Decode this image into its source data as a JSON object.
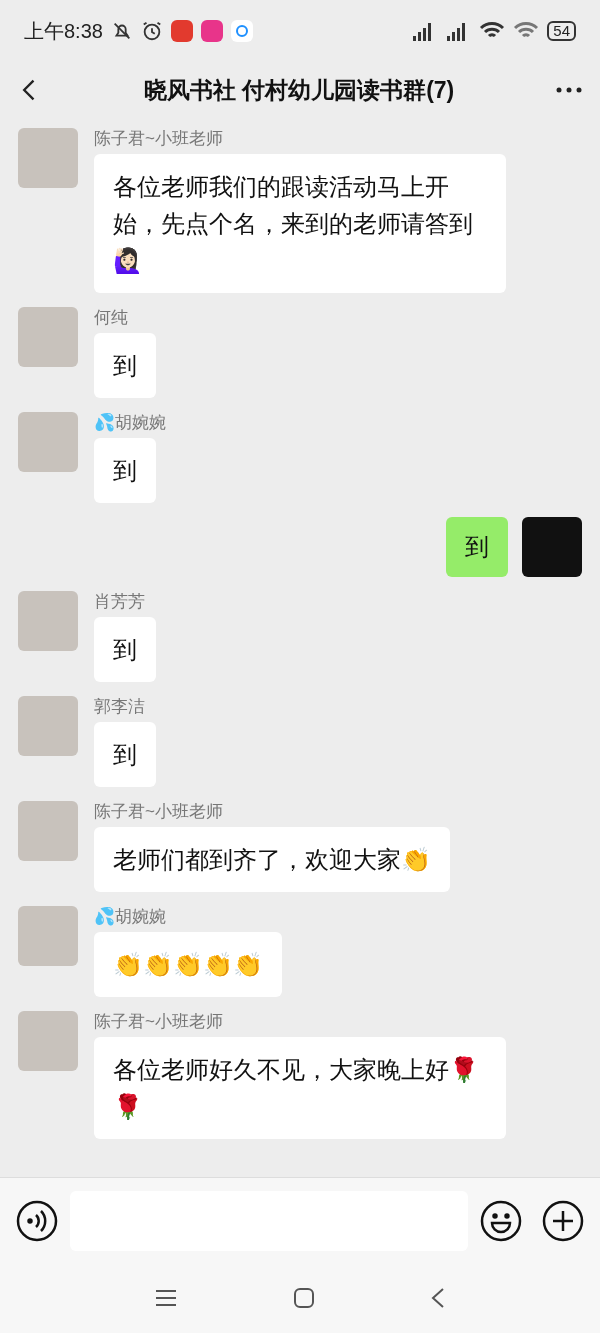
{
  "status_bar": {
    "time": "上午8:38",
    "battery": "54"
  },
  "header": {
    "title": "晓风书社 付村幼儿园读书群(7)"
  },
  "messages": [
    {
      "kind": "in",
      "sender": "陈子君~小班老师",
      "text": "各位老师我们的跟读活动马上开始，先点个名，来到的老师请答到🙋🏻‍♀️"
    },
    {
      "kind": "in",
      "sender": "何纯",
      "text": "到"
    },
    {
      "kind": "in",
      "sender": "💦胡婉婉",
      "text": "到"
    },
    {
      "kind": "out",
      "text": "到"
    },
    {
      "kind": "in",
      "sender": "肖芳芳",
      "text": "到"
    },
    {
      "kind": "in",
      "sender": "郭李洁",
      "text": "到"
    },
    {
      "kind": "in",
      "sender": "陈子君~小班老师",
      "text": "老师们都到齐了，欢迎大家👏"
    },
    {
      "kind": "in",
      "sender": "💦胡婉婉",
      "text": "👏👏👏👏👏"
    },
    {
      "kind": "in",
      "sender": "陈子君~小班老师",
      "text": "各位老师好久不见，大家晚上好🌹🌹"
    }
  ]
}
